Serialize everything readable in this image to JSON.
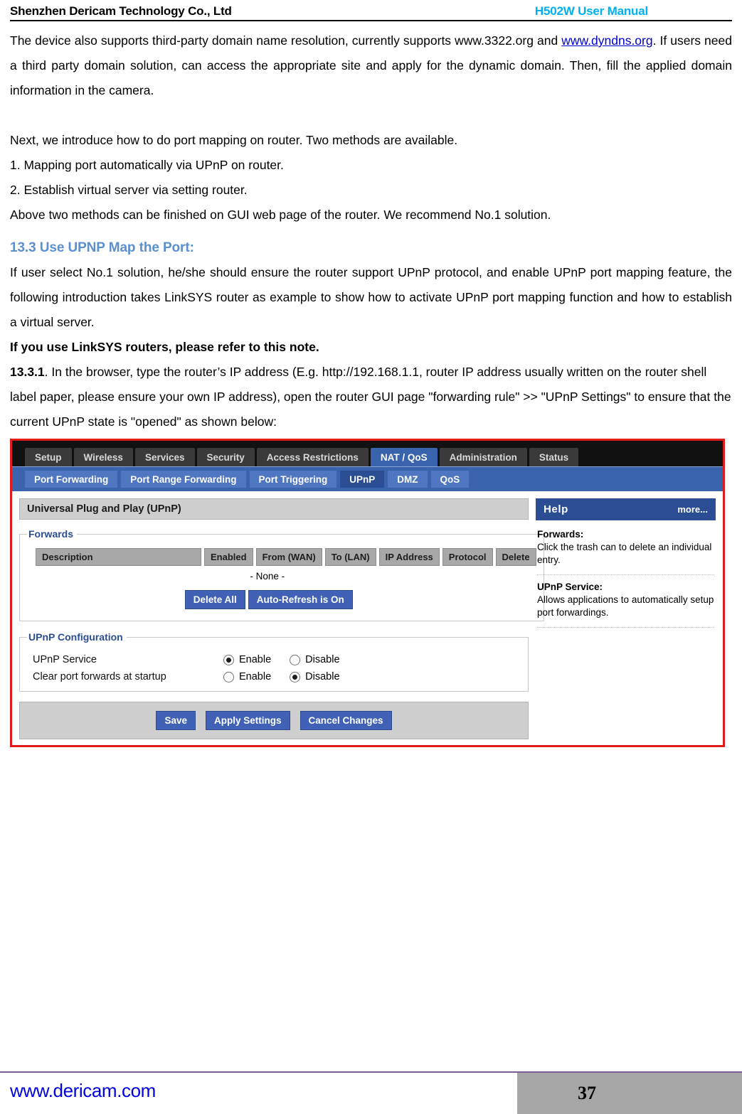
{
  "header": {
    "company": "Shenzhen Dericam Technology Co., Ltd",
    "manual": "H502W User Manual"
  },
  "body": {
    "para1_before_link": "The device also supports third-party domain name resolution, currently supports www.3322.org and ",
    "para1_link": "www.dyndns.org",
    "para1_after_link": ". If users need a third party domain solution, can access the appropriate site and apply for the dynamic domain. Then, fill the applied domain information in the camera.",
    "para2": "Next, we introduce how to do port mapping on router. Two methods are available.",
    "para3": "1. Mapping port automatically via UPnP on router.",
    "para4": "2. Establish virtual server via setting router.",
    "para5": "Above two methods can be finished on GUI web page of the router. We recommend No.1 solution.",
    "section_title": "13.3 Use UPNP Map the Port:",
    "para6": "If user select No.1 solution, he/she should ensure the router support UPnP protocol, and enable UPnP port mapping feature, the following introduction takes LinkSYS router as example to show how to activate UPnP port mapping function and how to establish a virtual server.",
    "bold_note": "If you use LinkSYS routers, please refer to this note.",
    "step_number": "13.3.1",
    "step_text": ". In the browser, type the router’s IP address (E.g. http://192.168.1.1, router IP address usually written on the router shell label paper, please ensure your own IP address), open the router GUI page \"forwarding rule\" >> \"UPnP Settings\" to ensure that the current UPnP state is \"opened\" as shown below:"
  },
  "screenshot": {
    "tabs": [
      {
        "label": "Setup",
        "active": false
      },
      {
        "label": "Wireless",
        "active": false
      },
      {
        "label": "Services",
        "active": false
      },
      {
        "label": "Security",
        "active": false
      },
      {
        "label": "Access Restrictions",
        "active": false
      },
      {
        "label": "NAT / QoS",
        "active": true
      },
      {
        "label": "Administration",
        "active": false
      },
      {
        "label": "Status",
        "active": false
      }
    ],
    "subtabs": [
      {
        "label": "Port Forwarding",
        "active": false
      },
      {
        "label": "Port Range Forwarding",
        "active": false
      },
      {
        "label": "Port Triggering",
        "active": false
      },
      {
        "label": "UPnP",
        "active": true
      },
      {
        "label": "DMZ",
        "active": false
      },
      {
        "label": "QoS",
        "active": false
      }
    ],
    "panel_title": "Universal Plug and Play (UPnP)",
    "forwards": {
      "legend": "Forwards",
      "columns": [
        "Description",
        "Enabled",
        "From (WAN)",
        "To (LAN)",
        "IP Address",
        "Protocol",
        "Delete"
      ],
      "empty_text": "- None -",
      "delete_all_label": "Delete All",
      "auto_refresh_label": "Auto-Refresh is On"
    },
    "configuration": {
      "legend": "UPnP Configuration",
      "rows": [
        {
          "label": "UPnP Service",
          "enable_label": "Enable",
          "disable_label": "Disable",
          "selected": "enable"
        },
        {
          "label": "Clear port forwards at startup",
          "enable_label": "Enable",
          "disable_label": "Disable",
          "selected": "disable"
        }
      ]
    },
    "actions": {
      "save_label": "Save",
      "apply_label": "Apply Settings",
      "cancel_label": "Cancel Changes"
    },
    "help": {
      "title": "Help",
      "more_label": "more...",
      "entries": [
        {
          "term": "Forwards:",
          "text": "Click the trash can to delete an individual entry."
        },
        {
          "term": "UPnP Service:",
          "text": "Allows applications to automatically setup port forwardings."
        }
      ]
    }
  },
  "footer": {
    "website": "www.dericam.com",
    "page_number": "37"
  },
  "colors": {
    "manual_cyan": "#00b0f0",
    "heading_blue": "#5b8fd0",
    "link_blue": "#0000cc",
    "screenshot_border_red": "#e01b1b",
    "tab_active_blue": "#3a63ad",
    "subtab_active_blue": "#2b4d94",
    "button_blue": "#4061b5",
    "footer_rule_purple": "#7a5f96",
    "footer_page_gray": "#a6a6a6"
  }
}
